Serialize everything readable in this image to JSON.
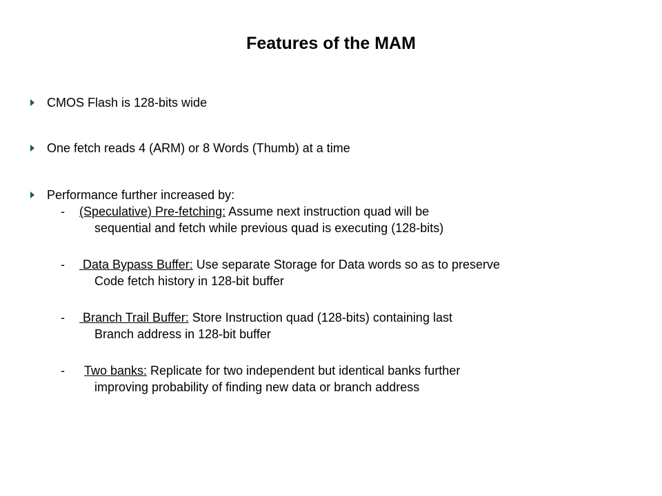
{
  "slide": {
    "title": "Features of the MAM",
    "bullet_icon": "triangle-right-icon",
    "accent_color": "#1e5a58",
    "bullets": [
      {
        "text": "CMOS Flash is 128-bits wide"
      },
      {
        "text": "One fetch reads 4 (ARM) or 8 Words (Thumb)  at a time"
      },
      {
        "text": "Performance further increased by:"
      }
    ],
    "subitems": [
      {
        "dash": "-",
        "term": "(Speculative) Pre-fetching:",
        "rest": " Assume next instruction quad will be",
        "line2": "sequential and fetch while previous quad is executing (128-bits)"
      },
      {
        "dash": "-",
        "term": " Data Bypass Buffer:",
        "rest": " Use separate Storage for Data words so as to preserve",
        "line2": "Code fetch history in 128-bit buffer"
      },
      {
        "dash": "-",
        "term": " Branch Trail Buffer:",
        "rest": " Store Instruction quad (128-bits) containing last",
        "line2": "Branch address in 128-bit buffer"
      },
      {
        "dash": "-",
        "term": "Two banks:",
        "rest": " Replicate for two independent but identical banks further",
        "line2": "improving probability of finding new data or branch address"
      }
    ]
  }
}
